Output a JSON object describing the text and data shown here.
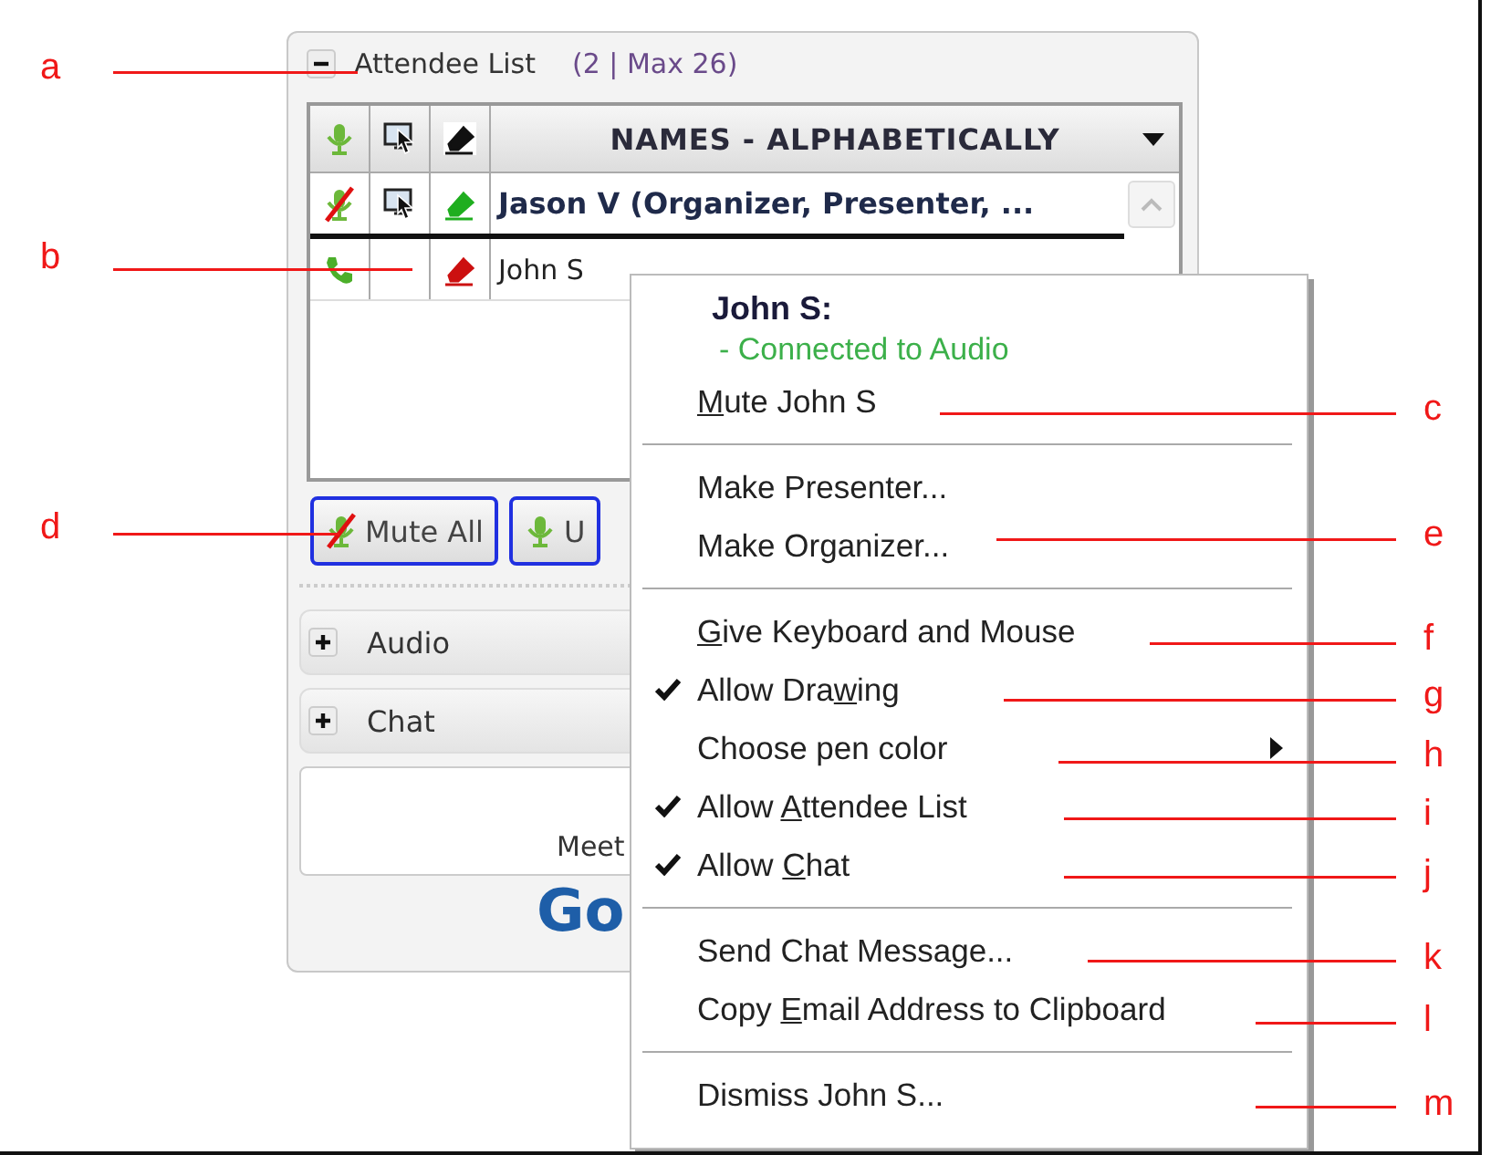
{
  "attendee_panel": {
    "title": "Attendee List",
    "count": "(2 | Max 26)",
    "expanded": true,
    "sort_label": "NAMES - ALPHABETICALLY",
    "attendees": [
      {
        "name": "Jason V (Organizer, Presenter, ...",
        "kind": "organizer",
        "on_phone": false,
        "muted": true,
        "screen": true,
        "color": "#1fae1f"
      },
      {
        "name": "John S",
        "kind": "attendee",
        "on_phone": true,
        "screen": false,
        "color": "#cc1010"
      }
    ],
    "buttons": [
      {
        "label": "Mute All",
        "muted": true
      },
      {
        "label": "U",
        "muted": false
      }
    ],
    "sections": [
      {
        "title": "Audio",
        "expanded": false
      },
      {
        "title": "Chat",
        "expanded": false
      }
    ],
    "footer_text": "Meet",
    "logo_text": "Go"
  },
  "context_menu": {
    "heading": "John S:",
    "status": "- Connected to Audio",
    "groups": [
      [
        {
          "key": "M",
          "after": "ute John S",
          "checked": false,
          "submenu": false
        }
      ],
      [
        {
          "before": "Make Presenter...",
          "checked": false,
          "submenu": false
        },
        {
          "before": "Make Organizer...",
          "checked": false,
          "submenu": false
        }
      ],
      [
        {
          "key": "G",
          "after": "ive Keyboard and Mouse",
          "checked": false,
          "submenu": false
        },
        {
          "before": "Allow Dra",
          "key": "w",
          "after": "ing",
          "checked": true,
          "submenu": false
        },
        {
          "before": "Choose pen color",
          "checked": false,
          "submenu": true
        },
        {
          "before": "Allow ",
          "key": "A",
          "after": "ttendee List",
          "checked": true,
          "submenu": false
        },
        {
          "before": "Allow ",
          "key": "C",
          "after": "hat",
          "checked": true,
          "submenu": false
        }
      ],
      [
        {
          "before": "Send Chat Message...",
          "checked": false,
          "submenu": false
        },
        {
          "before": "Copy ",
          "key": "E",
          "after": "mail Address to Clipboard",
          "checked": false,
          "submenu": false
        }
      ],
      [
        {
          "before": "Dismiss John S...",
          "checked": false,
          "submenu": false
        }
      ]
    ]
  },
  "callouts": [
    "a",
    "b",
    "c",
    "d",
    "e",
    "f",
    "g",
    "h",
    "i",
    "j",
    "k",
    "l",
    "m"
  ]
}
